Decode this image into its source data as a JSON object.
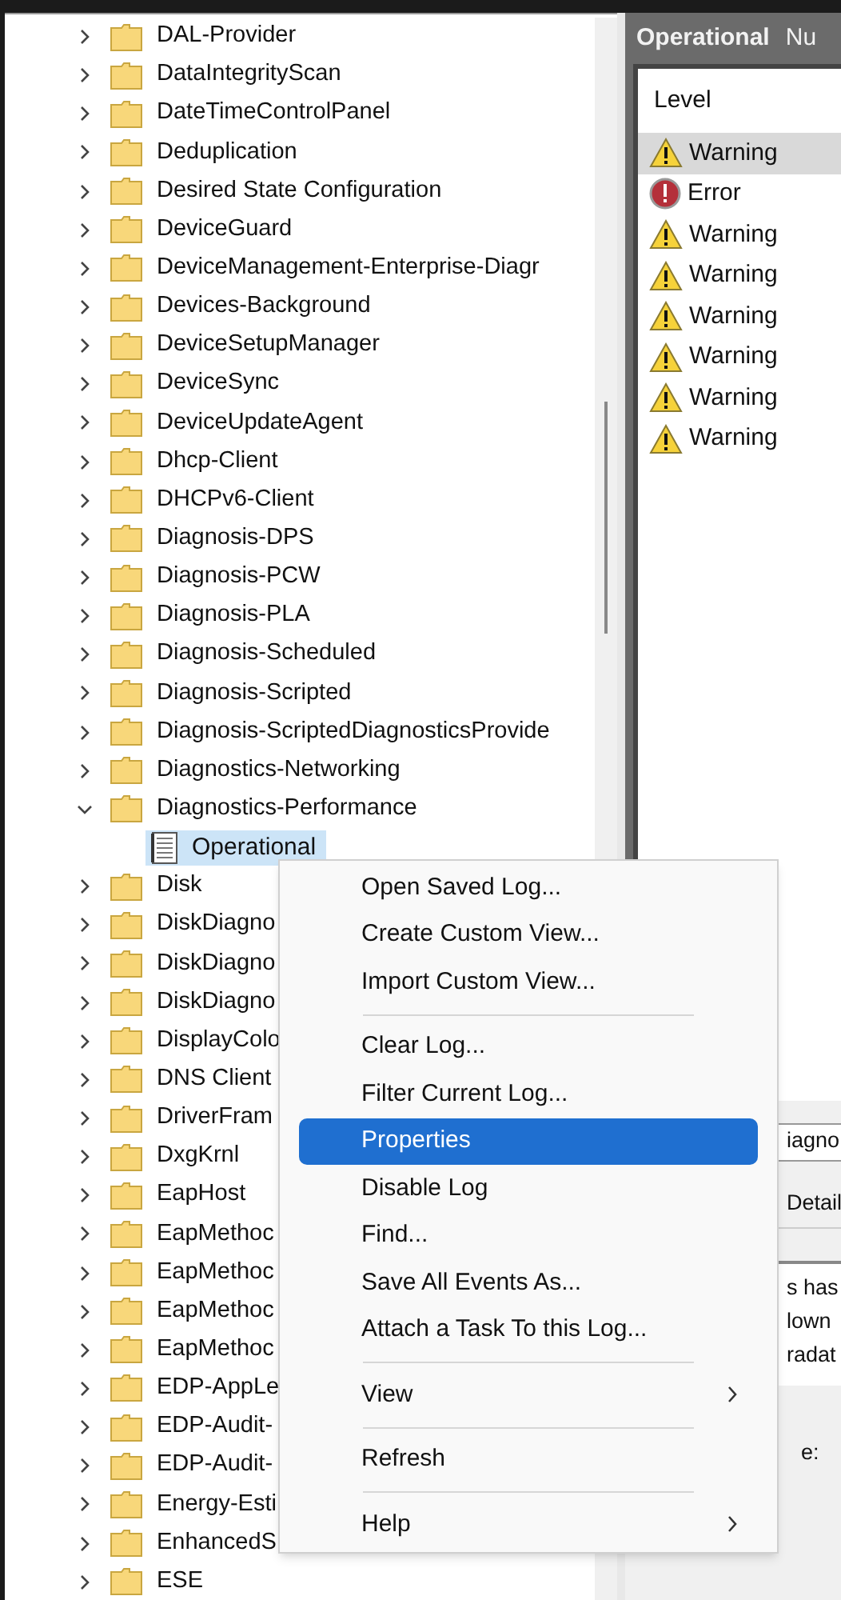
{
  "tree": {
    "items": [
      {
        "label": "DAL-Provider",
        "expanded": false,
        "selected": false
      },
      {
        "label": "DataIntegrityScan",
        "expanded": false,
        "selected": false
      },
      {
        "label": "DateTimeControlPanel",
        "expanded": false,
        "selected": false
      },
      {
        "label": "Deduplication",
        "expanded": false,
        "selected": false
      },
      {
        "label": "Desired State Configuration",
        "expanded": false,
        "selected": false
      },
      {
        "label": "DeviceGuard",
        "expanded": false,
        "selected": false
      },
      {
        "label": "DeviceManagement-Enterprise-Diagr",
        "expanded": false,
        "selected": false
      },
      {
        "label": "Devices-Background",
        "expanded": false,
        "selected": false
      },
      {
        "label": "DeviceSetupManager",
        "expanded": false,
        "selected": false
      },
      {
        "label": "DeviceSync",
        "expanded": false,
        "selected": false
      },
      {
        "label": "DeviceUpdateAgent",
        "expanded": false,
        "selected": false
      },
      {
        "label": "Dhcp-Client",
        "expanded": false,
        "selected": false
      },
      {
        "label": "DHCPv6-Client",
        "expanded": false,
        "selected": false
      },
      {
        "label": "Diagnosis-DPS",
        "expanded": false,
        "selected": false
      },
      {
        "label": "Diagnosis-PCW",
        "expanded": false,
        "selected": false
      },
      {
        "label": "Diagnosis-PLA",
        "expanded": false,
        "selected": false
      },
      {
        "label": "Diagnosis-Scheduled",
        "expanded": false,
        "selected": false
      },
      {
        "label": "Diagnosis-Scripted",
        "expanded": false,
        "selected": false
      },
      {
        "label": "Diagnosis-ScriptedDiagnosticsProvide",
        "expanded": false,
        "selected": false
      },
      {
        "label": "Diagnostics-Networking",
        "expanded": false,
        "selected": false
      },
      {
        "label": "Diagnostics-Performance",
        "expanded": true,
        "selected": false,
        "children": [
          {
            "label": "Operational",
            "selected": true
          }
        ]
      },
      {
        "label": "Disk",
        "expanded": false,
        "selected": false
      },
      {
        "label": "DiskDiagno",
        "expanded": false,
        "selected": false
      },
      {
        "label": "DiskDiagno",
        "expanded": false,
        "selected": false
      },
      {
        "label": "DiskDiagno",
        "expanded": false,
        "selected": false
      },
      {
        "label": "DisplayColo",
        "expanded": false,
        "selected": false
      },
      {
        "label": "DNS Client",
        "expanded": false,
        "selected": false
      },
      {
        "label": "DriverFram",
        "expanded": false,
        "selected": false
      },
      {
        "label": "DxgKrnl",
        "expanded": false,
        "selected": false
      },
      {
        "label": "EapHost",
        "expanded": false,
        "selected": false
      },
      {
        "label": "EapMethoc",
        "expanded": false,
        "selected": false
      },
      {
        "label": "EapMethoc",
        "expanded": false,
        "selected": false
      },
      {
        "label": "EapMethoc",
        "expanded": false,
        "selected": false
      },
      {
        "label": "EapMethoc",
        "expanded": false,
        "selected": false
      },
      {
        "label": "EDP-AppLe",
        "expanded": false,
        "selected": false
      },
      {
        "label": "EDP-Audit-",
        "expanded": false,
        "selected": false
      },
      {
        "label": "EDP-Audit-",
        "expanded": false,
        "selected": false
      },
      {
        "label": "Energy-Esti",
        "expanded": false,
        "selected": false
      },
      {
        "label": "EnhancedS",
        "expanded": false,
        "selected": false
      },
      {
        "label": "ESE",
        "expanded": false,
        "selected": false
      }
    ]
  },
  "log_pane": {
    "title": "Operational",
    "column_2_heading": "Nu",
    "list": {
      "column": "Level",
      "rows": [
        {
          "kind": "warning",
          "label": "Warning",
          "selected": true
        },
        {
          "kind": "error",
          "label": "Error",
          "selected": false
        },
        {
          "kind": "warning",
          "label": "Warning",
          "selected": false
        },
        {
          "kind": "warning",
          "label": "Warning",
          "selected": false
        },
        {
          "kind": "warning",
          "label": "Warning",
          "selected": false
        },
        {
          "kind": "warning",
          "label": "Warning",
          "selected": false
        },
        {
          "kind": "warning",
          "label": "Warning",
          "selected": false
        },
        {
          "kind": "warning",
          "label": "Warning",
          "selected": false
        }
      ]
    }
  },
  "event_details": {
    "header": "iagno",
    "tab": "Detail",
    "description_lines": [
      "s has",
      "lown",
      "radat"
    ],
    "field_label": "e:"
  },
  "context_menu": {
    "items": [
      {
        "kind": "item",
        "label": "Open Saved Log...",
        "selected": false
      },
      {
        "kind": "item",
        "label": "Create Custom View...",
        "selected": false
      },
      {
        "kind": "item",
        "label": "Import Custom View...",
        "selected": false
      },
      {
        "kind": "separator"
      },
      {
        "kind": "item",
        "label": "Clear Log...",
        "selected": false
      },
      {
        "kind": "item",
        "label": "Filter Current Log...",
        "selected": false
      },
      {
        "kind": "item",
        "label": "Properties",
        "selected": true
      },
      {
        "kind": "item",
        "label": "Disable Log",
        "selected": false
      },
      {
        "kind": "item",
        "label": "Find...",
        "selected": false
      },
      {
        "kind": "item",
        "label": "Save All Events As...",
        "selected": false
      },
      {
        "kind": "item",
        "label": "Attach a Task To this Log...",
        "selected": false
      },
      {
        "kind": "separator"
      },
      {
        "kind": "submenu",
        "label": "View",
        "selected": false
      },
      {
        "kind": "separator"
      },
      {
        "kind": "item",
        "label": "Refresh",
        "selected": false
      },
      {
        "kind": "separator"
      },
      {
        "kind": "submenu",
        "label": "Help",
        "selected": false
      }
    ]
  }
}
